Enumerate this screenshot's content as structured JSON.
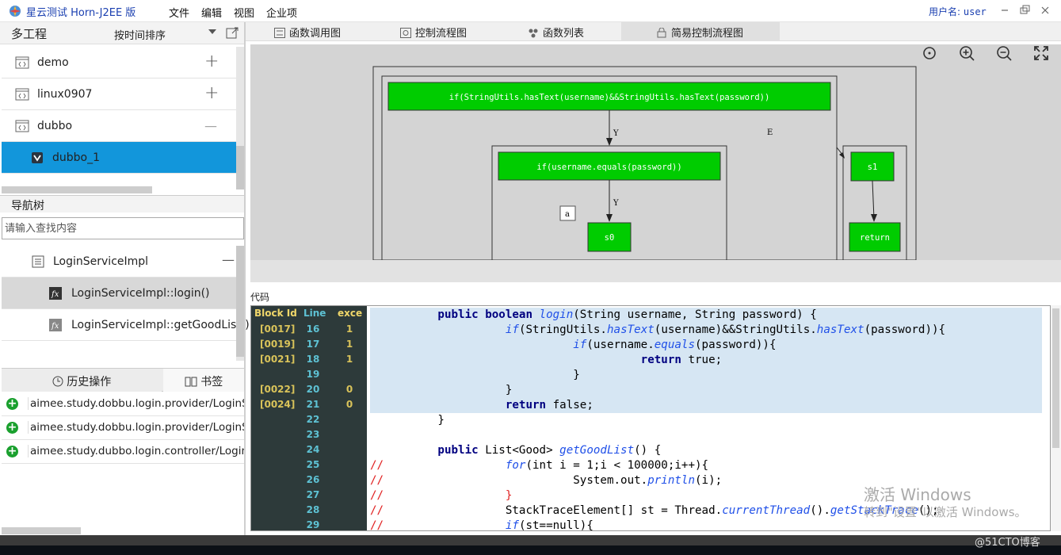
{
  "title_bar": {
    "app_title": "星云测试 Horn-J2EE 版",
    "menu": [
      "文件",
      "编辑",
      "视图",
      "企业项"
    ],
    "user_label": "用户名:",
    "user_name": "user"
  },
  "projects": {
    "header": "多工程",
    "sort_label": "按时间排序",
    "items": [
      {
        "label": "demo",
        "toggle": "+"
      },
      {
        "label": "linux0907",
        "toggle": "+"
      },
      {
        "label": "dubbo",
        "toggle": "—"
      },
      {
        "label": "dubbo_1",
        "toggle": ""
      }
    ]
  },
  "nav_tree": {
    "header": "导航树",
    "search_placeholder": "请输入查找内容",
    "items": [
      {
        "label": "LoginServiceImpl",
        "toggle": "—"
      },
      {
        "label": "LoginServiceImpl::login()"
      },
      {
        "label": "LoginServiceImpl::getGoodList()"
      }
    ]
  },
  "history": {
    "tabs": [
      "历史操作",
      "书签"
    ],
    "items": [
      "aimee.study.dobbu.login.provider/LoginServi",
      "aimee.study.dobbu.login.provider/LoginServi",
      "aimee.study.dubbo.login.controller/LoginCon"
    ]
  },
  "diagram_tabs": [
    "函数调用图",
    "控制流程图",
    "函数列表",
    "简易控制流程图"
  ],
  "diagram": {
    "nodes": {
      "n1": "if(StringUtils.hasText(username)&&StringUtils.hasText(password))",
      "n2": "if(username.equals(password))",
      "n3": "s0",
      "n4": "s1",
      "n5": "return"
    },
    "edge_labels": {
      "y1": "Y",
      "y2": "Y",
      "e": "E",
      "a": "a"
    },
    "colors": {
      "node_fill": "#00cc00",
      "canvas_bg": "#d4d4d4"
    }
  },
  "code": {
    "label": "代码",
    "gutter_headers": [
      "Block Id",
      "Line",
      "exce"
    ],
    "gutter_rows": [
      {
        "block": "[0017]",
        "line": "16",
        "exec": "1"
      },
      {
        "block": "[0019]",
        "line": "17",
        "exec": "1"
      },
      {
        "block": "[0021]",
        "line": "18",
        "exec": "1"
      },
      {
        "block": "",
        "line": "19",
        "exec": ""
      },
      {
        "block": "[0022]",
        "line": "20",
        "exec": "0"
      },
      {
        "block": "[0024]",
        "line": "21",
        "exec": "0"
      },
      {
        "block": "",
        "line": "22",
        "exec": ""
      },
      {
        "block": "",
        "line": "23",
        "exec": ""
      },
      {
        "block": "",
        "line": "24",
        "exec": ""
      },
      {
        "block": "",
        "line": "25",
        "exec": ""
      },
      {
        "block": "",
        "line": "26",
        "exec": ""
      },
      {
        "block": "",
        "line": "27",
        "exec": ""
      },
      {
        "block": "",
        "line": "28",
        "exec": ""
      },
      {
        "block": "",
        "line": "29",
        "exec": ""
      }
    ],
    "lines": [
      {
        "hl": true,
        "parts": [
          [
            "",
            "          "
          ],
          [
            "kw",
            "public boolean "
          ],
          [
            "it",
            "login"
          ],
          [
            "",
            "(String username, String password) {"
          ]
        ]
      },
      {
        "hl": true,
        "parts": [
          [
            "",
            "                    "
          ],
          [
            "it",
            "if"
          ],
          [
            "",
            "(StringUtils."
          ],
          [
            "it",
            "hasText"
          ],
          [
            "",
            "(username)&&StringUtils."
          ],
          [
            "it",
            "hasText"
          ],
          [
            "",
            "(password)){"
          ]
        ]
      },
      {
        "hl": true,
        "parts": [
          [
            "",
            "                              "
          ],
          [
            "it",
            "if"
          ],
          [
            "",
            "(username."
          ],
          [
            "it",
            "equals"
          ],
          [
            "",
            "(password)){"
          ]
        ]
      },
      {
        "hl": true,
        "parts": [
          [
            "",
            "                                        "
          ],
          [
            "kw",
            "return"
          ],
          [
            "",
            " true;"
          ]
        ]
      },
      {
        "hl": true,
        "parts": [
          [
            "",
            "                              }"
          ]
        ]
      },
      {
        "hl": true,
        "parts": [
          [
            "",
            "                    }"
          ]
        ]
      },
      {
        "hl": true,
        "parts": [
          [
            "",
            "                    "
          ],
          [
            "kw",
            "return"
          ],
          [
            "",
            " false;"
          ]
        ]
      },
      {
        "hl": false,
        "parts": [
          [
            "",
            "          }"
          ]
        ]
      },
      {
        "hl": false,
        "parts": [
          [
            "",
            ""
          ]
        ]
      },
      {
        "hl": false,
        "parts": [
          [
            "",
            "          "
          ],
          [
            "kw",
            "public"
          ],
          [
            "",
            " List<Good> "
          ],
          [
            "it",
            "getGoodList"
          ],
          [
            "",
            "() {"
          ]
        ]
      },
      {
        "hl": false,
        "parts": [
          [
            "cm",
            "//"
          ],
          [
            "",
            "                  "
          ],
          [
            "it",
            "for"
          ],
          [
            "",
            "(int i = 1;i < 100000;i++){"
          ]
        ]
      },
      {
        "hl": false,
        "parts": [
          [
            "cm",
            "//"
          ],
          [
            "",
            "                            System.out."
          ],
          [
            "it",
            "println"
          ],
          [
            "",
            "(i);"
          ]
        ]
      },
      {
        "hl": false,
        "parts": [
          [
            "cm",
            "//"
          ],
          [
            "",
            "                  "
          ],
          [
            "cm",
            "}"
          ]
        ]
      },
      {
        "hl": false,
        "parts": [
          [
            "cm",
            "//"
          ],
          [
            "",
            "                  StackTraceElement[] st = Thread."
          ],
          [
            "it",
            "currentThread"
          ],
          [
            "",
            "()."
          ],
          [
            "it",
            "getStackTrace"
          ],
          [
            "",
            "();"
          ]
        ]
      },
      {
        "hl": false,
        "parts": [
          [
            "cm",
            "//"
          ],
          [
            "",
            "                  "
          ],
          [
            "it",
            "if"
          ],
          [
            "",
            "(st==null){"
          ]
        ]
      }
    ]
  },
  "watermark": {
    "line1": "激活 Windows",
    "line2": "转到\"设置\"以激活 Windows。",
    "blog": "@51CTO博客"
  }
}
